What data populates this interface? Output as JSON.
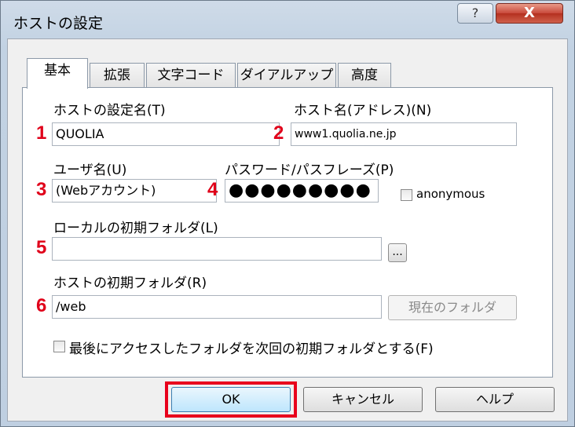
{
  "window": {
    "title": "ホストの設定",
    "help_button": "?",
    "close_button": "X"
  },
  "tabs": [
    "基本",
    "拡張",
    "文字コード",
    "ダイアルアップ",
    "高度"
  ],
  "form": {
    "host_setting_name_label": "ホストの設定名(T)",
    "host_setting_name_value": "QUOLIA",
    "host_name_label": "ホスト名(アドレス)(N)",
    "host_name_value": "www1.quolia.ne.jp",
    "user_name_label": "ユーザ名(U)",
    "user_name_value": "(Webアカウント)",
    "password_label": "パスワード/パスフレーズ(P)",
    "password_value": "●●●●●●●●●",
    "anonymous_label": "anonymous",
    "local_folder_label": "ローカルの初期フォルダ(L)",
    "local_folder_value": "",
    "browse_button": "...",
    "host_folder_label": "ホストの初期フォルダ(R)",
    "host_folder_value": "/web",
    "current_folder_button": "現在のフォルダ",
    "last_folder_label": "最後にアクセスしたフォルダを次回の初期フォルダとする(F)"
  },
  "annotations": [
    "1",
    "2",
    "3",
    "4",
    "5",
    "6"
  ],
  "buttons": {
    "ok": "OK",
    "cancel": "キャンセル",
    "help": "ヘルプ"
  },
  "colors": {
    "annotation_red": "#e0001a",
    "highlight_border": "#e8001c",
    "close_button": "#c8483a"
  }
}
